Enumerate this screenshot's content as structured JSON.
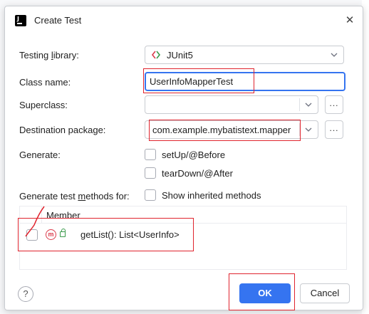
{
  "dialog": {
    "title": "Create Test",
    "close_glyph": "✕",
    "logo_letter": "J"
  },
  "form": {
    "testing_library": {
      "label_prefix": "Testing ",
      "label_mnemonic": "l",
      "label_suffix": "ibrary:",
      "value": "JUnit5",
      "icon": "junit-icon"
    },
    "class_name": {
      "label": "Class name:",
      "value": "UserInfoMapperTest"
    },
    "superclass": {
      "label": "Superclass:",
      "value": "",
      "browse": "..."
    },
    "destination_package": {
      "label": "Destination package:",
      "value": "com.example.mybatistext.mapper",
      "browse": "..."
    },
    "generate": {
      "label": "Generate:",
      "options": [
        {
          "label": "setUp/@Before",
          "checked": false
        },
        {
          "label": "tearDown/@After",
          "checked": false
        }
      ]
    },
    "generate_methods": {
      "label_prefix": "Generate test ",
      "label_mnemonic": "m",
      "label_suffix": "ethods for:",
      "show_inherited": {
        "label": "Show inherited methods",
        "checked": false
      }
    }
  },
  "members_table": {
    "header": "Member",
    "rows": [
      {
        "checked": false,
        "icon": "method-icon",
        "visibility": "public-lock-icon",
        "icon_letter": "m",
        "signature": "getList(): List<UserInfo>"
      }
    ]
  },
  "footer": {
    "help": "?",
    "ok": "OK",
    "cancel": "Cancel"
  },
  "colors": {
    "accent": "#3574f0",
    "annotation": "#e0242e"
  }
}
